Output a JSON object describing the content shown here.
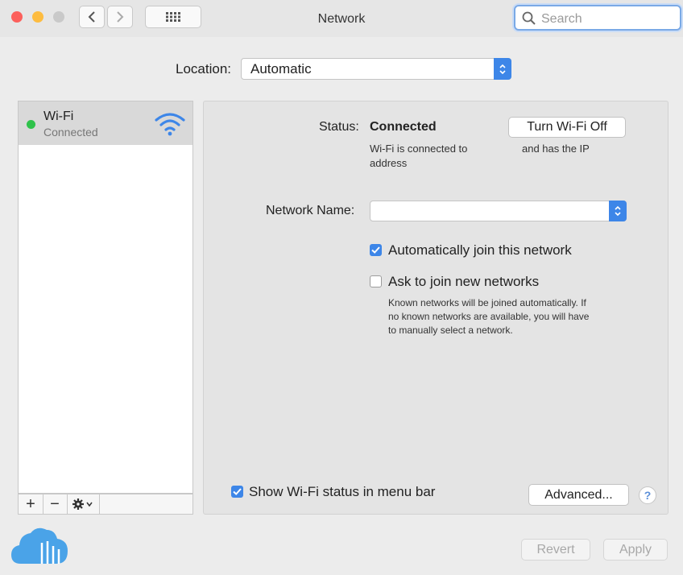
{
  "window": {
    "title": "Network"
  },
  "search": {
    "placeholder": "Search",
    "value": ""
  },
  "location": {
    "label": "Location:",
    "value": "Automatic"
  },
  "sidebar": {
    "items": [
      {
        "name": "Wi-Fi",
        "status": "Connected",
        "status_color": "#2fc24b"
      }
    ],
    "add_label": "+",
    "remove_label": "−"
  },
  "status": {
    "label": "Status:",
    "value": "Connected",
    "desc_line1": "Wi-Fi is connected to",
    "desc_line2": "address",
    "desc_right": "and has the IP"
  },
  "buttons": {
    "turn_off": "Turn Wi-Fi Off",
    "advanced": "Advanced...",
    "help": "?",
    "revert": "Revert",
    "apply": "Apply"
  },
  "network": {
    "label": "Network Name:",
    "value": ""
  },
  "options": {
    "auto_join": {
      "label": "Automatically join this network",
      "checked": true
    },
    "ask_join": {
      "label": "Ask to join new networks",
      "checked": false
    },
    "ask_desc_line1": "Known networks will be joined automatically. If",
    "ask_desc_line2": "no known networks are available, you will have",
    "ask_desc_line3": "to manually select a network.",
    "show_status": {
      "label": "Show Wi-Fi status in menu bar",
      "checked": true
    }
  },
  "colors": {
    "accent": "#3d86e8",
    "close": "#fc605c",
    "minimize": "#fdbc40",
    "zoom": "#c9c9c9"
  },
  "icons": [
    "chevron-left-icon",
    "chevron-right-icon",
    "grid-icon",
    "search-icon",
    "wifi-icon",
    "gear-icon",
    "cloud-logo-icon"
  ]
}
